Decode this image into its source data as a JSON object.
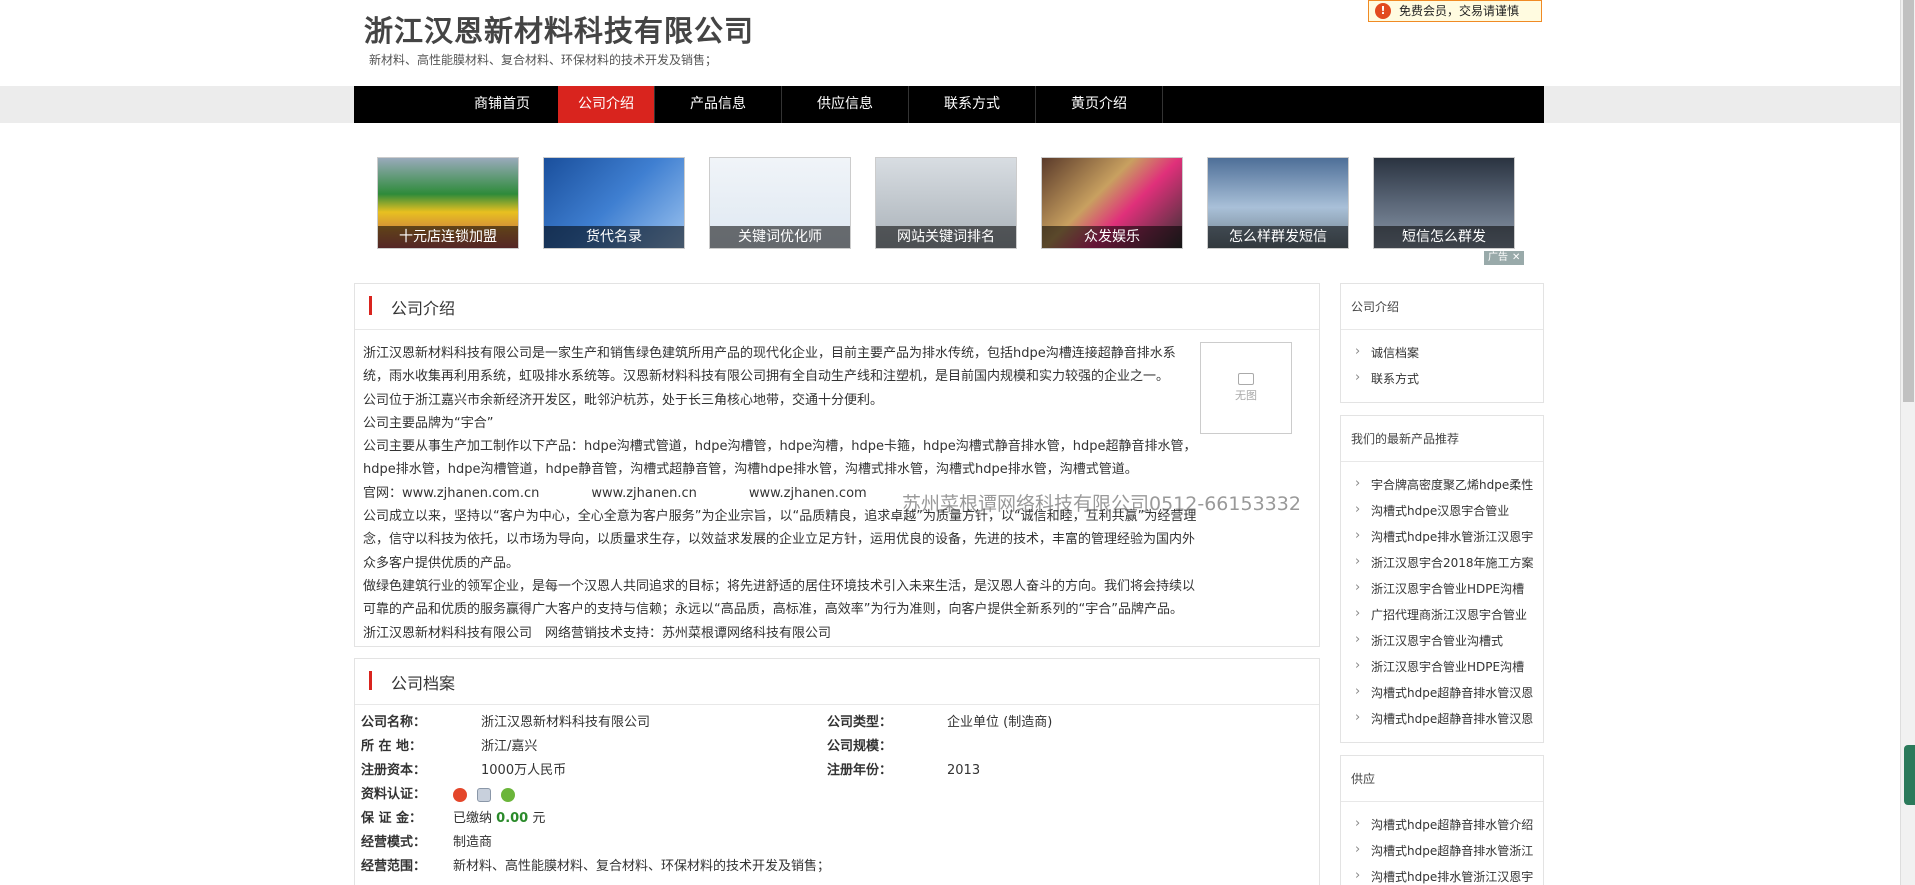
{
  "header": {
    "company_name": "浙江汉恩新材料科技有限公司",
    "company_desc": "新材料、高性能膜材料、复合材料、环保材料的技术开发及销售；",
    "member_badge": "免费会员，交易请谨慎"
  },
  "nav": [
    {
      "label": "商铺首页"
    },
    {
      "label": "公司介绍",
      "active": true
    },
    {
      "label": "产品信息"
    },
    {
      "label": "供应信息"
    },
    {
      "label": "联系方式"
    },
    {
      "label": "黄页介绍"
    }
  ],
  "ads": {
    "items": [
      {
        "caption": "十元店连锁加盟"
      },
      {
        "caption": "货代名录"
      },
      {
        "caption": "关键词优化师"
      },
      {
        "caption": "网站关键词排名"
      },
      {
        "caption": "众发娱乐"
      },
      {
        "caption": "怎么样群发短信"
      },
      {
        "caption": "短信怎么群发"
      }
    ],
    "flag_label": "广告",
    "close": "✕"
  },
  "intro": {
    "title": "公司介绍",
    "no_image_label": "无图",
    "paragraphs": [
      " 浙江汉恩新材料科技有限公司是一家生产和销售绿色建筑所用产品的现代化企业，目前主要产品为排水传统，包括hdpe沟槽连接超静音排水系统，雨水收集再利用系统，虹吸排水系统等。汉恩新材料科技有限公司拥有全自动生产线和注塑机，是目前国内规模和实力较强的企业之一。",
      "公司位于浙江嘉兴市余新经济开发区，毗邻沪杭苏，处于长三角核心地带，交通十分便利。",
      "公司主要品牌为“宇合”",
      "公司主要从事生产加工制作以下产品：hdpe沟槽式管道，hdpe沟槽管，hdpe沟槽，hdpe卡箍，hdpe沟槽式静音排水管，hdpe超静音排水管，hdpe排水管，hdpe沟槽管道，hdpe静音管，沟槽式超静音管，沟槽hdpe排水管，沟槽式排水管，沟槽式hdpe排水管，沟槽式管道。",
      "官网：www.zjhanen.com.cn　　　　www.zjhanen.cn　　　　www.zjhanen.com",
      "公司成立以来，坚持以“客户为中心，全心全意为客户服务”为企业宗旨，以“品质精良，追求卓越”为质量方针，以“诚信和睦，互利共赢”为经营理念，信守以科技为依托，以市场为导向，以质量求生存，以效益求发展的企业立足方针，运用优良的设备，先进的技术，丰富的管理经验为国内外众多客户提供优质的产品。",
      "做绿色建筑行业的领军企业，是每一个汉恩人共同追求的目标；将先进舒适的居住环境技术引入未来生活，是汉恩人奋斗的方向。我们将会持续以可靠的产品和优质的服务赢得广大客户的支持与信赖；永远以“高品质，高标准，高效率”为行为准则，向客户提供全新系列的“宇合”品牌产品。",
      "浙江汉恩新材料科技有限公司　网络营销技术支持：苏州菜根谭网络科技有限公司"
    ]
  },
  "archive": {
    "title": "公司档案",
    "company_name_label": "公司名称：",
    "company_name": "浙江汉恩新材料科技有限公司",
    "company_type_label": "公司类型：",
    "company_type": "企业单位 (制造商)",
    "location_label": "所 在 地：",
    "location": "浙江/嘉兴",
    "scale_label": "公司规模：",
    "scale": "",
    "capital_label": "注册资本：",
    "capital": "1000万人民币",
    "reg_year_label": "注册年份：",
    "reg_year": "2013",
    "cert_label": "资料认证：",
    "deposit_label": "保 证 金：",
    "deposit_prefix": "已缴纳",
    "deposit_amount": "0.00",
    "deposit_unit": "元",
    "mode_label": "经营模式：",
    "mode": "制造商",
    "scope_label": "经营范围：",
    "scope": "新材料、高性能膜材料、复合材料、环保材料的技术开发及销售；"
  },
  "sidebar": {
    "intro_title": "公司介绍",
    "intro_links": [
      "诚信档案",
      "联系方式"
    ],
    "new_products_title": "我们的最新产品推荐",
    "new_products": [
      "宇合牌高密度聚乙烯hdpe柔性",
      "沟槽式hdpe汉恩宇合管业",
      "沟槽式hdpe排水管浙江汉恩宇",
      "浙江汉恩宇合2018年施工方案",
      "浙江汉恩宇合管业HDPE沟槽",
      "广招代理商浙江汉恩宇合管业",
      "浙江汉恩宇合管业沟槽式",
      "浙江汉恩宇合管业HDPE沟槽",
      "沟槽式hdpe超静音排水管汉恩",
      "沟槽式hdpe超静音排水管汉恩"
    ],
    "supply_title": "供应",
    "supply": [
      "沟槽式hdpe超静音排水管介绍",
      "沟槽式hdpe超静音排水管浙江",
      "沟槽式hdpe排水管浙江汉恩宇"
    ]
  },
  "watermark": "苏州菜根谭网络科技有限公司0512-66153332"
}
